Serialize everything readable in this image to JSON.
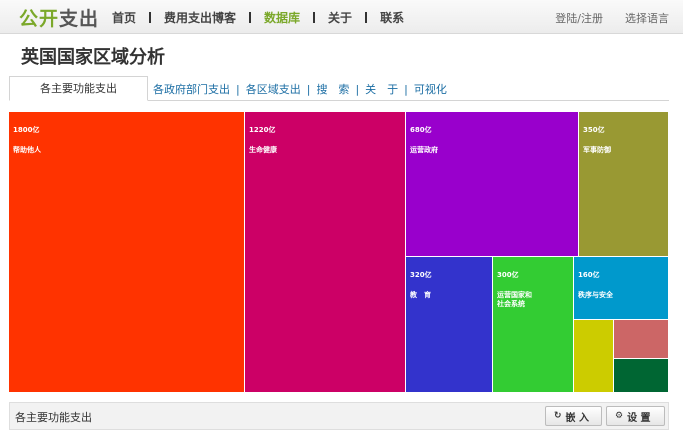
{
  "header": {
    "logo_part1": "公开",
    "logo_part2": "支出",
    "nav": [
      {
        "label": "首页",
        "active": false
      },
      {
        "label": "费用支出博客",
        "active": false
      },
      {
        "label": "数据库",
        "active": true
      },
      {
        "label": "关于",
        "active": false
      },
      {
        "label": "联系",
        "active": false
      }
    ],
    "login_label": "登陆/注册",
    "language_label": "选择语言"
  },
  "page_title": "英国国家区域分析",
  "tabs": {
    "active": "各主要功能支出",
    "links": [
      "各政府部门支出",
      "各区域支出",
      "搜　索",
      "关　于",
      "可视化"
    ]
  },
  "treemap": {
    "colors": {
      "help_others": "#ff3300",
      "health": "#cc0066",
      "government": "#9900cc",
      "defense": "#999933",
      "education": "#3333cc",
      "national_social": "#33cc33",
      "order_safety": "#0099cc",
      "small_yellow": "#cccc00",
      "small_rose": "#cc6666",
      "small_green": "#006633"
    },
    "cells": [
      {
        "key": "help_others",
        "value": "1800亿",
        "name": "帮助他人"
      },
      {
        "key": "health",
        "value": "1220亿",
        "name": "生命健康"
      },
      {
        "key": "government",
        "value": "680亿",
        "name": "运营政府"
      },
      {
        "key": "defense",
        "value": "350亿",
        "name": "军事防御"
      },
      {
        "key": "education",
        "value": "320亿",
        "name": "教　育"
      },
      {
        "key": "national_social",
        "value": "300亿",
        "name": "运营国家和\n社会系统"
      },
      {
        "key": "order_safety",
        "value": "160亿",
        "name": "秩序与安全"
      },
      {
        "key": "small_yellow",
        "value": "",
        "name": ""
      },
      {
        "key": "small_rose",
        "value": "",
        "name": ""
      },
      {
        "key": "small_green",
        "value": "",
        "name": ""
      }
    ]
  },
  "footer": {
    "label": "各主要功能支出",
    "embed_label": "嵌 入",
    "settings_label": "设 置",
    "embed_icon": "refresh-icon",
    "settings_icon": "gear-icon"
  }
}
